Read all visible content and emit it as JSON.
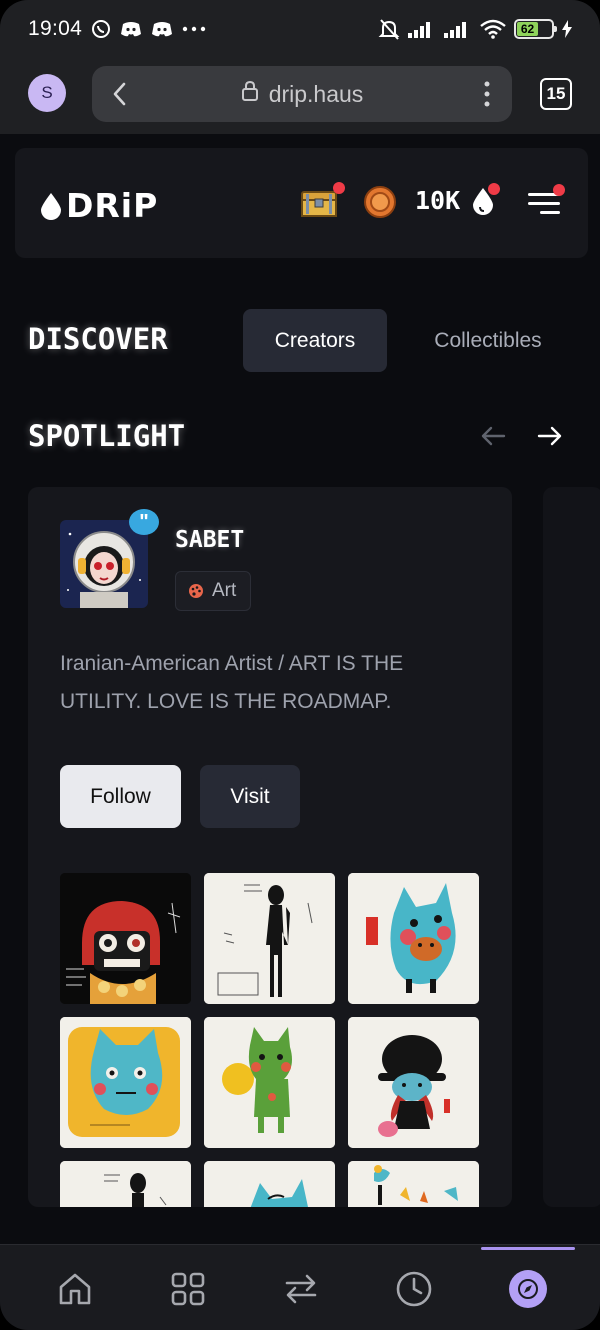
{
  "status_bar": {
    "time": "19:04",
    "battery_level": "62"
  },
  "browser": {
    "profile_initial": "S",
    "url": "drip.haus",
    "tab_count": "15"
  },
  "header": {
    "logo_text": "DRiP",
    "coins": "10K"
  },
  "discover": {
    "title": "DISCOVER",
    "tabs": [
      {
        "label": "Creators",
        "active": true
      },
      {
        "label": "Collectibles",
        "active": false
      }
    ]
  },
  "spotlight": {
    "title": "SPOTLIGHT",
    "creator": {
      "name": "SABET",
      "tag": "Art",
      "bio": "Iranian-American Artist / ART IS THE UTILITY. LOVE IS THE ROADMAP.",
      "follow_label": "Follow",
      "visit_label": "Visit"
    },
    "gallery": [
      {
        "name": "artwork-red-helmet-skull"
      },
      {
        "name": "artwork-black-figure"
      },
      {
        "name": "artwork-blue-cat-bear"
      },
      {
        "name": "artwork-blue-cat-yellow"
      },
      {
        "name": "artwork-green-cat"
      },
      {
        "name": "artwork-black-hat-girl"
      },
      {
        "name": "artwork-black-figure-small"
      },
      {
        "name": "artwork-blue-creature"
      },
      {
        "name": "artwork-blue-bird"
      }
    ]
  },
  "colors": {
    "accent": "#b3a0f5",
    "notification": "#ef3b47",
    "background": "#0b0c10",
    "card": "#16171c"
  }
}
